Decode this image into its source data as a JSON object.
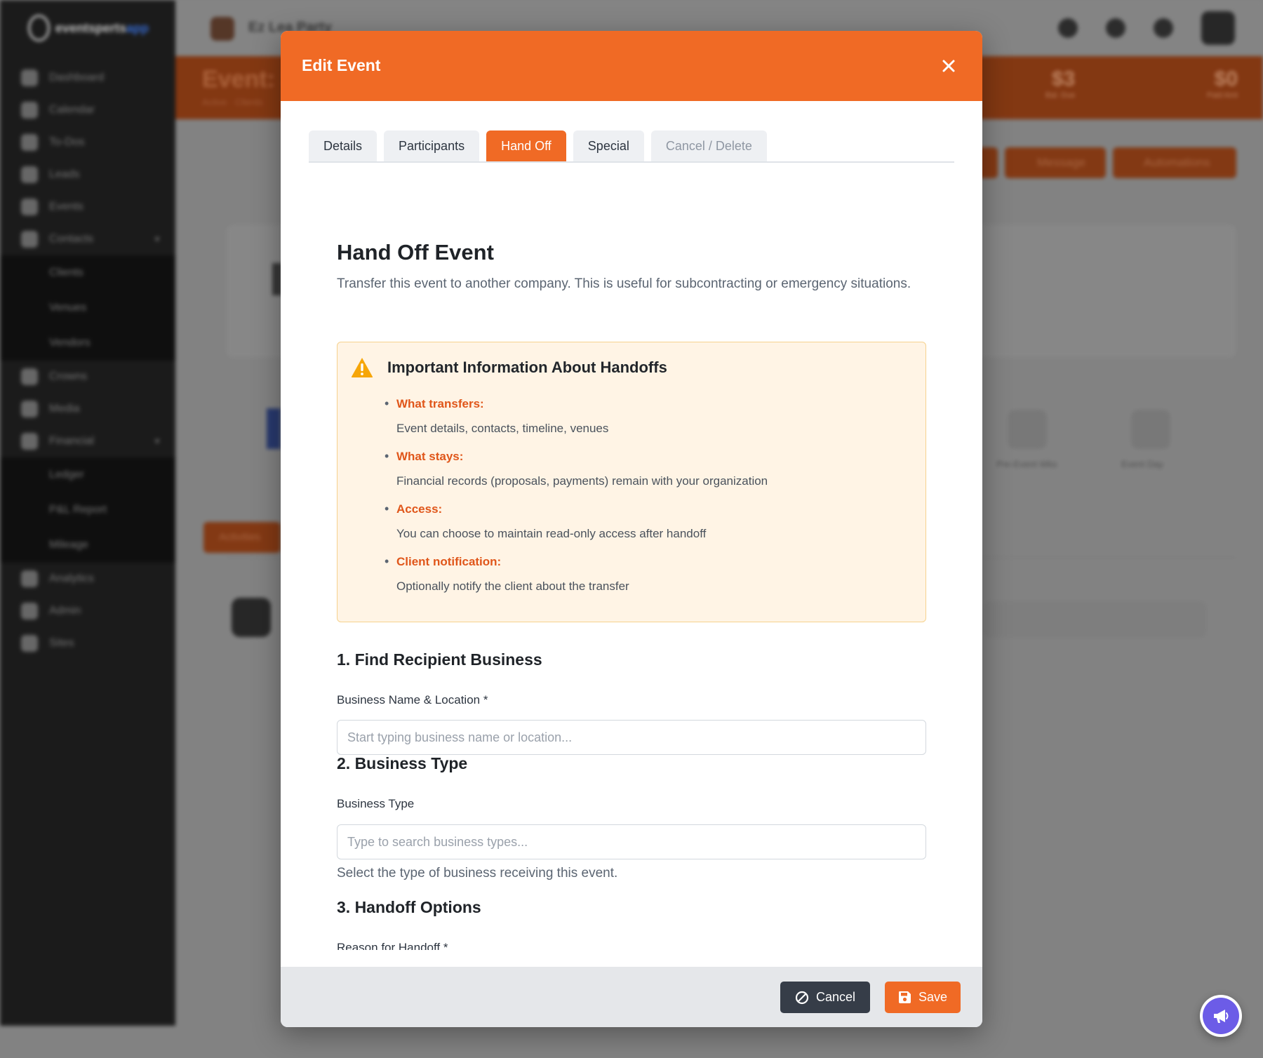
{
  "background": {
    "brand_name": "eventsperts",
    "brand_suffix": "app",
    "app_title": "Ez Lea Party",
    "page_title": "Event: S",
    "page_subtitle": "Active · Clients",
    "stat_1": {
      "value": "$3",
      "label": "Bal. Due"
    },
    "stat_2": {
      "value": "$0",
      "label": "Paid Amt"
    },
    "button_message": "Message",
    "button_automations": "Automations",
    "button_activities": "Activities",
    "sidebar": [
      {
        "label": "Dashboard"
      },
      {
        "label": "Calendar"
      },
      {
        "label": "To-Dos"
      },
      {
        "label": "Leads"
      },
      {
        "label": "Events"
      },
      {
        "label": "Contacts"
      },
      {
        "label": "Clients"
      },
      {
        "label": "Venues"
      },
      {
        "label": "Vendors"
      },
      {
        "label": "Crowns"
      },
      {
        "label": "Media"
      },
      {
        "label": "Financial"
      },
      {
        "label": "Ledger"
      },
      {
        "label": "P&L Report"
      },
      {
        "label": "Mileage"
      },
      {
        "label": "Analytics"
      },
      {
        "label": "Admin"
      },
      {
        "label": "Sites"
      }
    ],
    "progress_labels": [
      "Pre-Event Wks",
      "Event Day"
    ]
  },
  "modal": {
    "title": "Edit Event",
    "tabs": [
      {
        "label": "Details"
      },
      {
        "label": "Participants"
      },
      {
        "label": "Hand Off"
      },
      {
        "label": "Special"
      },
      {
        "label": "Cancel / Delete"
      }
    ],
    "heading": "Hand Off Event",
    "lead": "Transfer this event to another company. This is useful for subcontracting or emergency situations.",
    "info": {
      "title": "Important Information About Handoffs",
      "items": [
        {
          "label": "What transfers:",
          "value": "Event details, contacts, timeline, venues"
        },
        {
          "label": "What stays:",
          "value": "Financial records (proposals, payments) remain with your organization"
        },
        {
          "label": "Access:",
          "value": "You can choose to maintain read-only access after handoff"
        },
        {
          "label": "Client notification:",
          "value": "Optionally notify the client about the transfer"
        }
      ]
    },
    "section1": {
      "title": "1. Find Recipient Business",
      "label": "Business Name & Location *",
      "placeholder": "Start typing business name or location..."
    },
    "section2": {
      "title": "2. Business Type",
      "label": "Business Type",
      "placeholder": "Type to search business types...",
      "help": "Select the type of business receiving this event."
    },
    "section3": {
      "title": "3. Handoff Options",
      "label": "Reason for Handoff *"
    },
    "footer": {
      "cancel_label": "Cancel",
      "save_label": "Save"
    }
  },
  "colors": {
    "accent": "#f06a25",
    "dark_button": "#363d48",
    "warning_bg": "#fff4e5",
    "warning_icon": "#f6a609",
    "fab": "#6c5ce7"
  }
}
